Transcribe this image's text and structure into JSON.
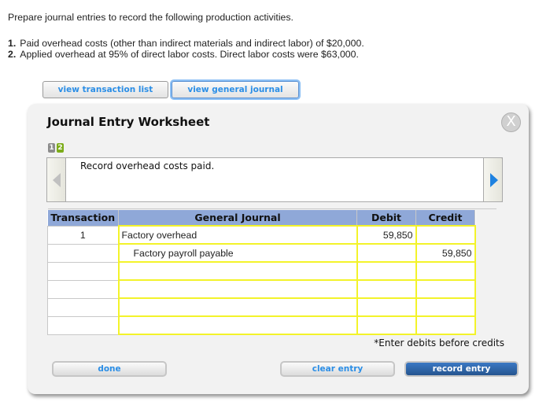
{
  "prompt": "Prepare journal entries to record the following production activities.",
  "steps": [
    {
      "num": "1.",
      "text": "Paid overhead costs (other than indirect materials and indirect labor) of $20,000."
    },
    {
      "num": "2.",
      "text": "Applied overhead at 95% of direct labor costs. Direct labor costs were $63,000."
    }
  ],
  "tabs": {
    "transaction_list": "view transaction list",
    "general_journal": "view general journal"
  },
  "worksheet": {
    "title": "Journal Entry Worksheet",
    "close_icon": "X",
    "step_badges": [
      "1",
      "2"
    ],
    "active_step": "2",
    "description": "Record overhead costs paid.",
    "table": {
      "headers": [
        "Transaction",
        "General Journal",
        "Debit",
        "Credit"
      ],
      "rows": [
        {
          "transaction": "1",
          "account": "Factory overhead",
          "debit": "59,850",
          "credit": ""
        },
        {
          "transaction": "",
          "account": "Factory payroll payable",
          "debit": "",
          "credit": "59,850"
        },
        {
          "transaction": "",
          "account": "",
          "debit": "",
          "credit": ""
        },
        {
          "transaction": "",
          "account": "",
          "debit": "",
          "credit": ""
        },
        {
          "transaction": "",
          "account": "",
          "debit": "",
          "credit": ""
        },
        {
          "transaction": "",
          "account": "",
          "debit": "",
          "credit": ""
        }
      ]
    },
    "note": "*Enter debits before credits",
    "buttons": {
      "done": "done",
      "clear": "clear entry",
      "record": "record entry"
    }
  },
  "colors": {
    "header_bg": "#8fa8d8",
    "input_border": "#f3f32a",
    "badge_inactive": "#8c8c8c",
    "badge_active": "#7cac1a",
    "link_blue": "#2b8ee6",
    "record_button": "#2f64a8"
  }
}
